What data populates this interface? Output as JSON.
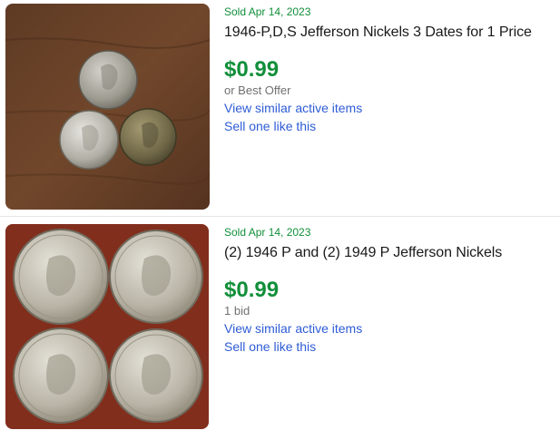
{
  "listings": [
    {
      "sold_date": "Sold Apr 14, 2023",
      "title": "1946-P,D,S Jefferson Nickels 3 Dates for 1 Price",
      "price": "$0.99",
      "purchase_info": "or Best Offer",
      "similar_link": "View similar active items",
      "sell_link": "Sell one like this"
    },
    {
      "sold_date": "Sold Apr 14, 2023",
      "title": "(2) 1946 P and (2) 1949 P Jefferson Nickels",
      "price": "$0.99",
      "purchase_info": "1 bid",
      "similar_link": "View similar active items",
      "sell_link": "Sell one like this"
    }
  ],
  "colors": {
    "sold_green": "#118f3a",
    "link_blue": "#2e5cd6",
    "secondary_text": "#707070"
  }
}
